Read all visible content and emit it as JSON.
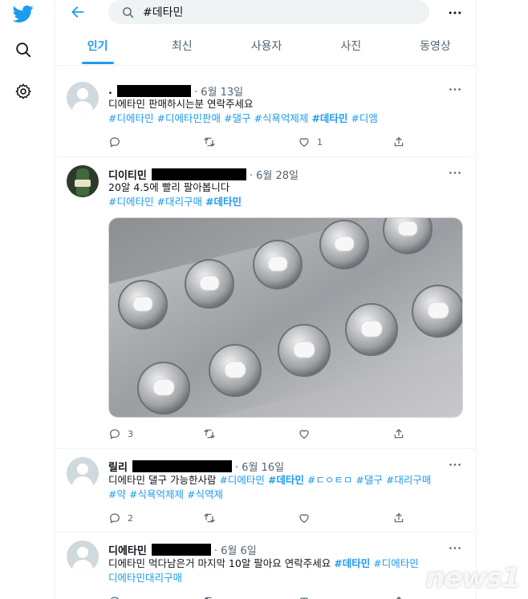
{
  "search": {
    "value": "#데타민"
  },
  "tabs": [
    "인기",
    "최신",
    "사용자",
    "사진",
    "동영상"
  ],
  "tweets": [
    {
      "name": ".",
      "date": "· 6월 13일",
      "text": "디에타민 판매하시는분 연락주세요",
      "tags": [
        {
          "t": "#디에타민",
          "b": false
        },
        {
          "t": "#디에타민판매",
          "b": false
        },
        {
          "t": "#댈구",
          "b": false
        },
        {
          "t": "#식욕억제제",
          "b": false
        },
        {
          "t": "#데타민",
          "b": true
        },
        {
          "t": "#디엠",
          "b": false
        }
      ],
      "replies": "",
      "likes": "1"
    },
    {
      "name": "디이티민",
      "date": "· 6월 28일",
      "text": "20알 4.5에 빨리 팔아봅니다",
      "tags": [
        {
          "t": "#디에타민",
          "b": false
        },
        {
          "t": "#대리구매",
          "b": false
        },
        {
          "t": "#데타민",
          "b": true
        }
      ],
      "replies": "3",
      "likes": ""
    },
    {
      "name": "릴리",
      "date": "· 6월 16일",
      "text": "디에타민 댈구 가능한사람",
      "tags": [
        {
          "t": "#디에타민",
          "b": false
        },
        {
          "t": "#데타민",
          "b": true
        },
        {
          "t": "#ㄷㅇㅌㅁ",
          "b": false
        },
        {
          "t": "#댈구",
          "b": false
        },
        {
          "t": "#대리구매",
          "b": false
        }
      ],
      "tags2": [
        {
          "t": "#약",
          "b": false
        },
        {
          "t": "#식욕억제제",
          "b": false
        },
        {
          "t": "#식역제",
          "b": false
        }
      ],
      "replies": "2",
      "likes": ""
    },
    {
      "name": "디에타민",
      "date": "· 6월 6일",
      "text": "디에타민 먹다남은거 마지막 10알 팔아요 연락주세요",
      "tags": [
        {
          "t": "#데타민",
          "b": true
        },
        {
          "t": "#디에타민",
          "b": false
        }
      ],
      "line3": "디에타민대리구매",
      "replies": "",
      "likes": ""
    }
  ],
  "watermark": "news1",
  "colors": {
    "accent": "#1d9bf0",
    "muted": "#536471",
    "text": "#0f1419"
  }
}
